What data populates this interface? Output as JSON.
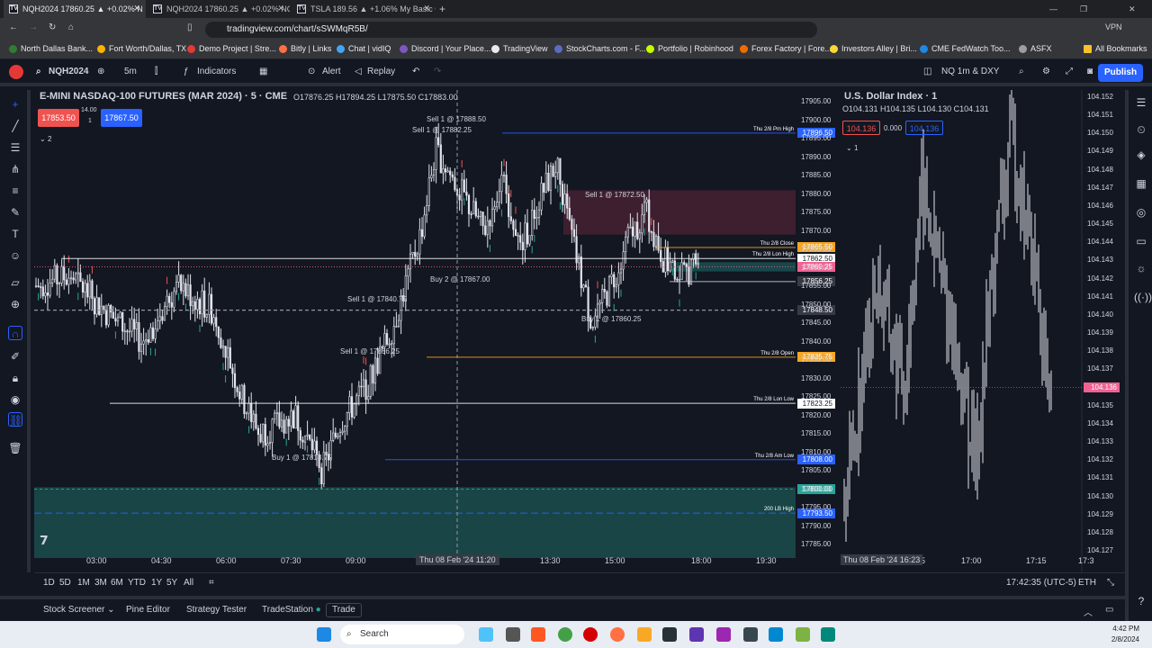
{
  "browser": {
    "tabs": [
      {
        "label": "NQH2024 17860.25 ▲ +0.02% N",
        "active": true
      },
      {
        "label": "NQH2024 17860.25 ▲ +0.02% NQ 5m",
        "active": false
      },
      {
        "label": "TSLA 189.56 ▲ +1.06% My Basic Chart",
        "active": false
      }
    ],
    "url": "tradingview.com/chart/sSWMqR5B/",
    "vpn_label": "VPN",
    "bookmarks": [
      "North Dallas Bank...",
      "Fort Worth/Dallas, TX",
      "Demo Project | Stre...",
      "Bitly | Links",
      "Chat | vidIQ",
      "Discord | Your Place...",
      "TradingView",
      "StockCharts.com - F...",
      "Portfolio | Robinhood",
      "Forex Factory | Fore...",
      "Investors Alley | Bri...",
      "CME FedWatch Too...",
      "ASFX",
      "All Bookmarks"
    ]
  },
  "toolbar": {
    "symbol": "NQH2024",
    "interval": "5m",
    "indicators_label": "Indicators",
    "alert_label": "Alert",
    "replay_label": "Replay",
    "layout_name": "NQ 1m & DXY",
    "publish_label": "Publish"
  },
  "pane1": {
    "title": "E-MINI NASDAQ-100 FUTURES (MAR 2024) · 5 · CME",
    "ohlc": "O17876.25 H17894.25 L17875.50 C17883.00",
    "sell_price": "17853.50",
    "spread": "14.00",
    "qty": "1",
    "buy_price": "17867.50",
    "indicator_count": "2",
    "price_ticks": [
      "17905.00",
      "17900.00",
      "17895.00",
      "17890.00",
      "17885.00",
      "17880.00",
      "17875.00",
      "17870.00",
      "17865.00",
      "17860.00",
      "17855.00",
      "17850.00",
      "17845.00",
      "17840.00",
      "17835.00",
      "17830.00",
      "17825.00",
      "17820.00",
      "17815.00",
      "17810.00",
      "17805.00",
      "17800.00",
      "17795.00",
      "17790.00",
      "17785.00"
    ],
    "time_ticks": [
      "03:00",
      "04:30",
      "06:00",
      "07:30",
      "09:00",
      "13:30",
      "15:00",
      "18:00",
      "19:30"
    ],
    "crosshair_time": "Thu 08 Feb '24   11:20",
    "levels": [
      {
        "name": "Thu 2/8 Pm High",
        "price": "17896.50",
        "color": "#2962ff"
      },
      {
        "name": "Thu 2/8 Close",
        "price": "17865.50",
        "color": "#f5a623"
      },
      {
        "name": "Thu 2/8 Lon High",
        "price": "17862.50",
        "color": "#ffffff"
      },
      {
        "name": "",
        "price": "17860.25",
        "color": "#f06292"
      },
      {
        "name": "",
        "price": "17856.25",
        "color": "#363a45"
      },
      {
        "name": "",
        "price": "17848.50",
        "color": "#363a45"
      },
      {
        "name": "Thu 2/8 Open",
        "price": "17835.75",
        "color": "#f5a623"
      },
      {
        "name": "Thu 2/8 Lon Low",
        "price": "17823.25",
        "color": "#ffffff"
      },
      {
        "name": "Thu 2/8 Am Low",
        "price": "17808.00",
        "color": "#2962ff"
      },
      {
        "name": "",
        "price": "17800.00",
        "color": "#26a69a"
      },
      {
        "name": "200 LB High",
        "price": "17793.50",
        "color": "#2962ff"
      }
    ],
    "annotations": [
      "Sell 1 @ 17888.50",
      "Sell 1 @ 17882.25",
      "Sell 1 @ 17872.50",
      "Buy 2 @ 17867.00",
      "Sell 1 @ 17840.75",
      "Buy 1 @ 17860.25",
      "Sell 1 @ 17836.25",
      "Buy 1 @ 17818.75"
    ],
    "crosshair_price": "17848.50"
  },
  "pane2": {
    "title": "U.S. Dollar Index · 1",
    "ohlc": "O104.131 H104.135 L104.130 C104.131",
    "sell_price": "104.136",
    "spread": "0.000",
    "buy_price": "104.136",
    "indicator_count": "1",
    "price_ticks": [
      "104.152",
      "104.151",
      "104.150",
      "104.149",
      "104.148",
      "104.147",
      "104.146",
      "104.145",
      "104.144",
      "104.143",
      "104.142",
      "104.141",
      "104.140",
      "104.139",
      "104.138",
      "104.137",
      "104.136",
      "104.135",
      "104.134",
      "104.133",
      "104.132",
      "104.131",
      "104.130",
      "104.129",
      "104.128",
      "104.127"
    ],
    "last_price": "104.136",
    "time_ticks": [
      "45",
      "17:00",
      "17:15",
      "17:3"
    ],
    "crosshair_time": "Thu 08 Feb '24   16:23"
  },
  "range_bar": {
    "ranges": [
      "1D",
      "5D",
      "1M",
      "3M",
      "6M",
      "YTD",
      "1Y",
      "5Y",
      "All"
    ],
    "clock": "17:42:35 (UTC-5)",
    "session": "ETH"
  },
  "bottom_panel": {
    "tabs": [
      "Stock Screener",
      "Pine Editor",
      "Strategy Tester",
      "TradeStation",
      "Trade"
    ]
  },
  "taskbar": {
    "search_placeholder": "Search",
    "time": "4:42 PM",
    "date": "2/8/2024"
  },
  "colors": {
    "bg": "#131722",
    "up": "#26a69a",
    "down": "#ef5350",
    "accent": "#2962ff"
  }
}
